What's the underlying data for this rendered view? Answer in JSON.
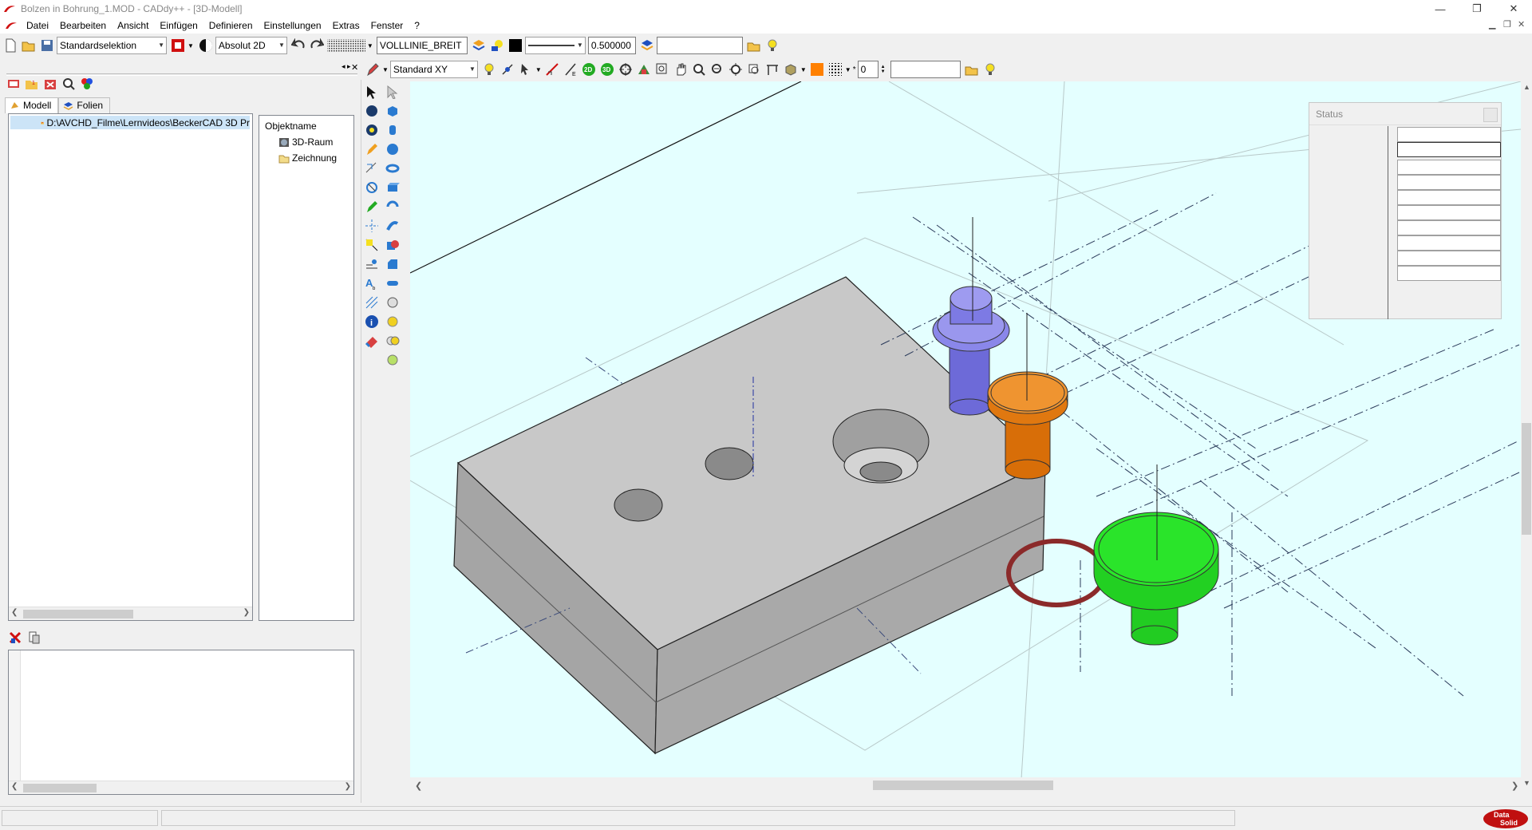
{
  "window": {
    "title": "Bolzen in Bohrung_1.MOD  -  CADdy++ - [3D-Modell]",
    "controls": [
      "—",
      "❐",
      "✕"
    ]
  },
  "menu": {
    "items": [
      "Datei",
      "Bearbeiten",
      "Ansicht",
      "Einfügen",
      "Definieren",
      "Einstellungen",
      "Extras",
      "Fenster",
      "?"
    ]
  },
  "toolbar1": {
    "selection_mode": "Standardselektion",
    "coord_mode": "Absolut 2D",
    "linetype": "VOLLLINIE_BREIT",
    "line_width": "0.500000",
    "layer_field": ""
  },
  "toolbar2": {
    "view_plane": "Standard XY",
    "label_2d": "2D",
    "label_3d": "3D",
    "spin_value": "0",
    "layer_field": ""
  },
  "left_panel": {
    "tabs": [
      {
        "label": "Modell"
      },
      {
        "label": "Folien"
      }
    ],
    "file_path": "D:\\AVCHD_Filme\\Lernvideos\\BeckerCAD 3D Pr",
    "object_header": "Objektname",
    "objects": [
      "3D-Raum",
      "Zeichnung"
    ]
  },
  "status_panel": {
    "title": "Status",
    "rows": [
      "",
      "",
      "",
      "",
      "",
      "",
      "",
      "",
      "",
      ""
    ]
  },
  "statusbar": {
    "left": "",
    "middle": ""
  },
  "colors": {
    "viewport_bg": "#e4ffff",
    "block_top": "#c8c8c8",
    "block_side": "#a7a7a7",
    "bolt_blue": "#7a77e6",
    "bolt_orange": "#e8820f",
    "bolt_green": "#22dd22",
    "oring": "#8b2a2a"
  }
}
